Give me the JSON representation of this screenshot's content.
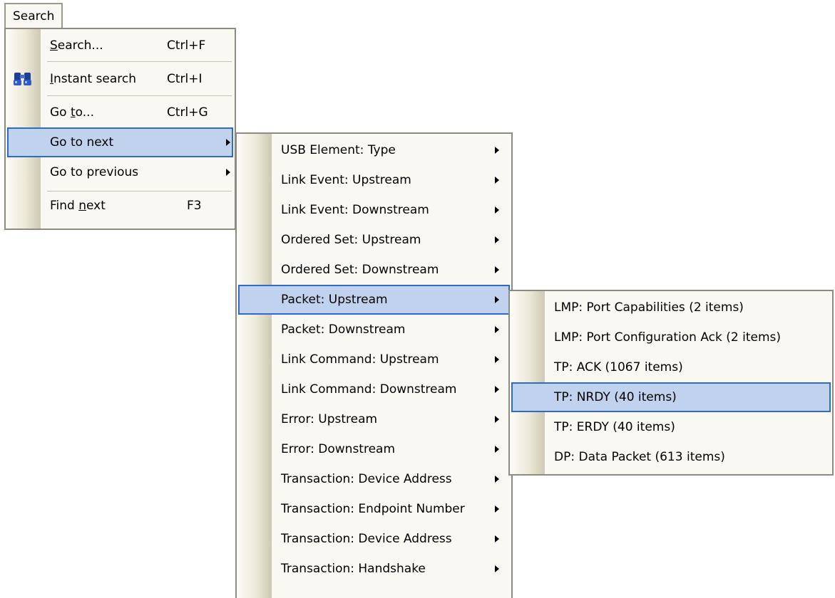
{
  "menubar": {
    "title": "Search"
  },
  "menu_main": {
    "items": [
      {
        "label_pre": "",
        "label_u": "S",
        "label_post": "earch...",
        "shortcut": "Ctrl+F"
      },
      {
        "label_pre": "",
        "label_u": "I",
        "label_post": "nstant search",
        "shortcut": "Ctrl+I",
        "icon": "binoculars-icon"
      },
      {
        "label_pre": "Go ",
        "label_u": "t",
        "label_post": "o...",
        "shortcut": "Ctrl+G"
      },
      {
        "label": "Go to next",
        "submenu": true,
        "selected": true
      },
      {
        "label": "Go to previous",
        "submenu": true
      },
      {
        "label_pre": "Find ",
        "label_u": "n",
        "label_post": "ext",
        "shortcut": "F3"
      }
    ]
  },
  "menu_goto_next": {
    "items": [
      "USB Element: Type",
      "Link Event: Upstream",
      "Link Event: Downstream",
      "Ordered Set: Upstream",
      "Ordered Set: Downstream",
      "Packet: Upstream",
      "Packet: Downstream",
      "Link Command: Upstream",
      "Link Command: Downstream",
      "Error: Upstream",
      "Error: Downstream",
      "Transaction: Device Address",
      "Transaction: Endpoint Number",
      "Transaction: Device Address",
      "Transaction: Handshake"
    ],
    "selected_index": 5
  },
  "menu_packet_upstream": {
    "items": [
      "LMP: Port Capabilities (2 items)",
      "LMP: Port Configuration Ack (2 items)",
      "TP: ACK (1067 items)",
      "TP: NRDY (40 items)",
      "TP: ERDY (40 items)",
      "DP: Data Packet (613 items)"
    ],
    "selected_index": 3
  },
  "colors": {
    "menu_background": "#f9f8f3",
    "selection_fill": "#c1d2ee",
    "selection_border": "#316ac5"
  }
}
